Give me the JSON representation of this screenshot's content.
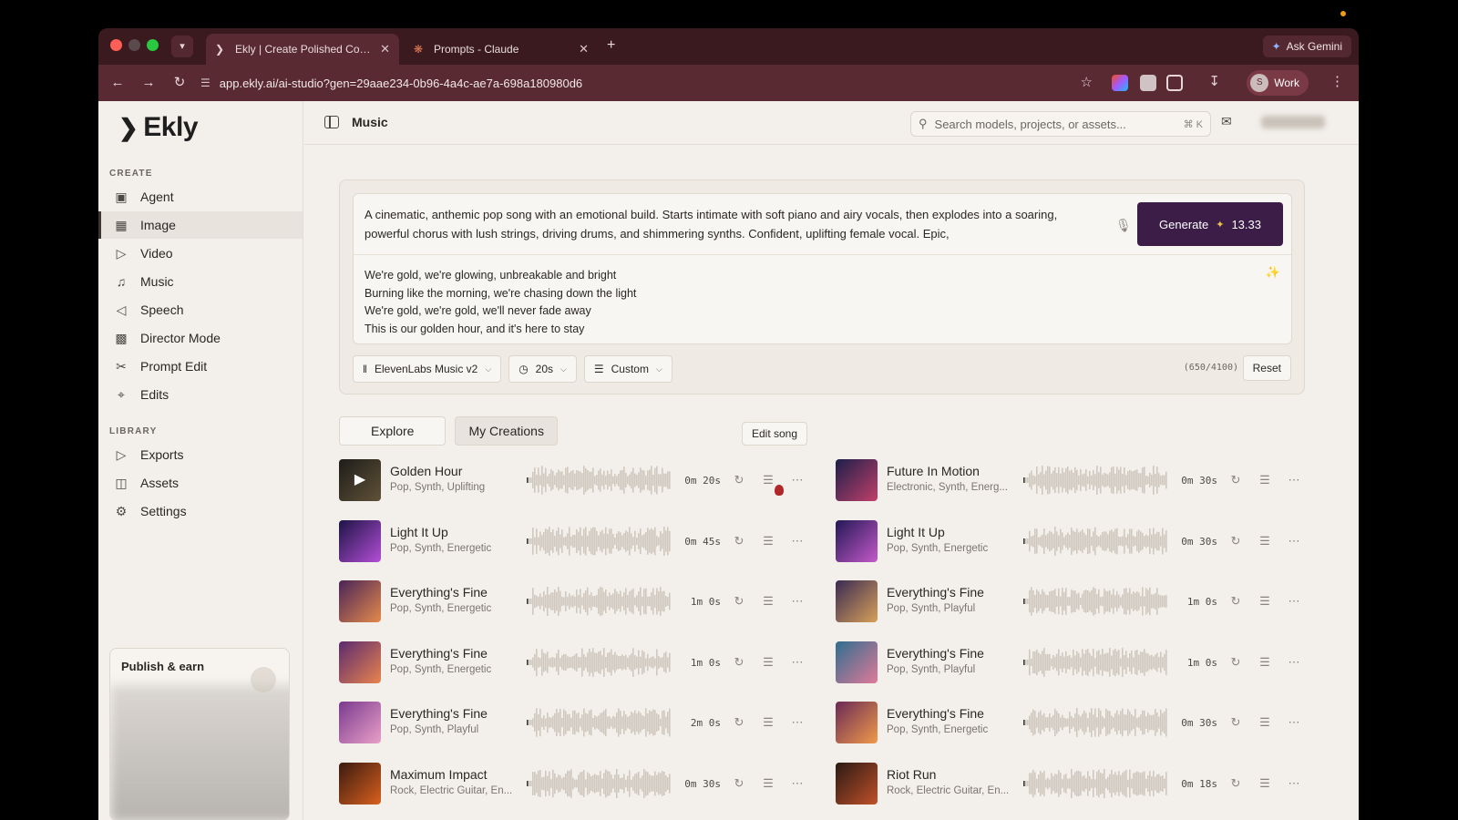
{
  "browser": {
    "tabs": [
      {
        "title": "Ekly | Create Polished Content",
        "active": true
      },
      {
        "title": "Prompts - Claude",
        "active": false
      }
    ],
    "gemini_label": "Ask Gemini",
    "url": "app.ekly.ai/ai-studio?gen=29aae234-0b96-4a4c-ae7a-698a180980d6",
    "profile_initial": "S",
    "profile_label": "Work"
  },
  "app": {
    "logo": "Ekly",
    "header_title": "Music",
    "search_placeholder": "Search models, projects, or assets...",
    "search_shortcut": "⌘ K"
  },
  "sidebar": {
    "create_label": "CREATE",
    "create_items": [
      {
        "label": "Agent",
        "icon": "robot-icon"
      },
      {
        "label": "Image",
        "icon": "image-icon",
        "active": true
      },
      {
        "label": "Video",
        "icon": "video-icon"
      },
      {
        "label": "Music",
        "icon": "audio-waveform-icon"
      },
      {
        "label": "Speech",
        "icon": "speaker-icon"
      },
      {
        "label": "Director Mode",
        "icon": "clapperboard-icon"
      },
      {
        "label": "Prompt Edit",
        "icon": "scissors-icon"
      },
      {
        "label": "Edits",
        "icon": "crop-icon"
      }
    ],
    "library_label": "LIBRARY",
    "library_items": [
      {
        "label": "Exports",
        "icon": "play-outline-icon"
      },
      {
        "label": "Assets",
        "icon": "stack-icon"
      },
      {
        "label": "Settings",
        "icon": "gear-icon"
      }
    ],
    "publish_title": "Publish & earn"
  },
  "composer": {
    "prompt": "A cinematic, anthemic pop song with an emotional build. Starts intimate with soft piano and airy vocals, then explodes into a soaring, powerful chorus with lush strings, driving drums, and shimmering synths. Confident, uplifting female vocal. Epic,",
    "lyrics": [
      "We're gold, we're glowing, unbreakable and bright",
      "Burning like the morning, we're chasing down the light",
      "We're gold, we're gold, we'll never fade away",
      "This is our golden hour, and it's here to stay"
    ],
    "generate_label": "Generate",
    "credits": "13.33",
    "model": "ElevenLabs Music v2",
    "duration": "20s",
    "mode": "Custom",
    "counter": "(650/4100)",
    "reset_label": "Reset"
  },
  "library_tabs": [
    {
      "label": "Explore"
    },
    {
      "label": "My Creations",
      "selected": true
    }
  ],
  "tooltip": "Edit song",
  "tracks": [
    {
      "name": "Golden Hour",
      "genre": "Pop, Synth, Uplifting",
      "duration": "0m 20s",
      "colors": [
        "#2b2a26",
        "#8a7550"
      ]
    },
    {
      "name": "Future In Motion",
      "genre": "Electronic, Synth, Energ...",
      "duration": "0m 30s",
      "colors": [
        "#1c1f4a",
        "#c0406a"
      ]
    },
    {
      "name": "Light It Up",
      "genre": "Pop, Synth, Energetic",
      "duration": "0m 45s",
      "colors": [
        "#1d1446",
        "#b44ed6"
      ]
    },
    {
      "name": "Light It Up",
      "genre": "Pop, Synth, Energetic",
      "duration": "0m 30s",
      "colors": [
        "#231855",
        "#c459c9"
      ]
    },
    {
      "name": "Everything's Fine",
      "genre": "Pop, Synth, Energetic",
      "duration": "1m 0s",
      "colors": [
        "#4a2457",
        "#e38a4b"
      ]
    },
    {
      "name": "Everything's Fine",
      "genre": "Pop, Synth, Playful",
      "duration": "1m 0s",
      "colors": [
        "#3a2a52",
        "#d7a05a"
      ]
    },
    {
      "name": "Everything's Fine",
      "genre": "Pop, Synth, Energetic",
      "duration": "1m 0s",
      "colors": [
        "#5b2a6e",
        "#e8844f"
      ]
    },
    {
      "name": "Everything's Fine",
      "genre": "Pop, Synth, Playful",
      "duration": "1m 0s",
      "colors": [
        "#2f6e8e",
        "#e07a9a"
      ]
    },
    {
      "name": "Everything's Fine",
      "genre": "Pop, Synth, Playful",
      "duration": "2m 0s",
      "colors": [
        "#7a3a8e",
        "#e8a0c8"
      ]
    },
    {
      "name": "Everything's Fine",
      "genre": "Pop, Synth, Energetic",
      "duration": "0m 30s",
      "colors": [
        "#6a2a55",
        "#f09a4a"
      ]
    },
    {
      "name": "Maximum Impact",
      "genre": "Rock, Electric Guitar, En...",
      "duration": "0m 30s",
      "colors": [
        "#3a1a10",
        "#d9601e"
      ]
    },
    {
      "name": "Riot Run",
      "genre": "Rock, Electric Guitar, En...",
      "duration": "0m 18s",
      "colors": [
        "#2a1a14",
        "#c0502a"
      ]
    }
  ]
}
